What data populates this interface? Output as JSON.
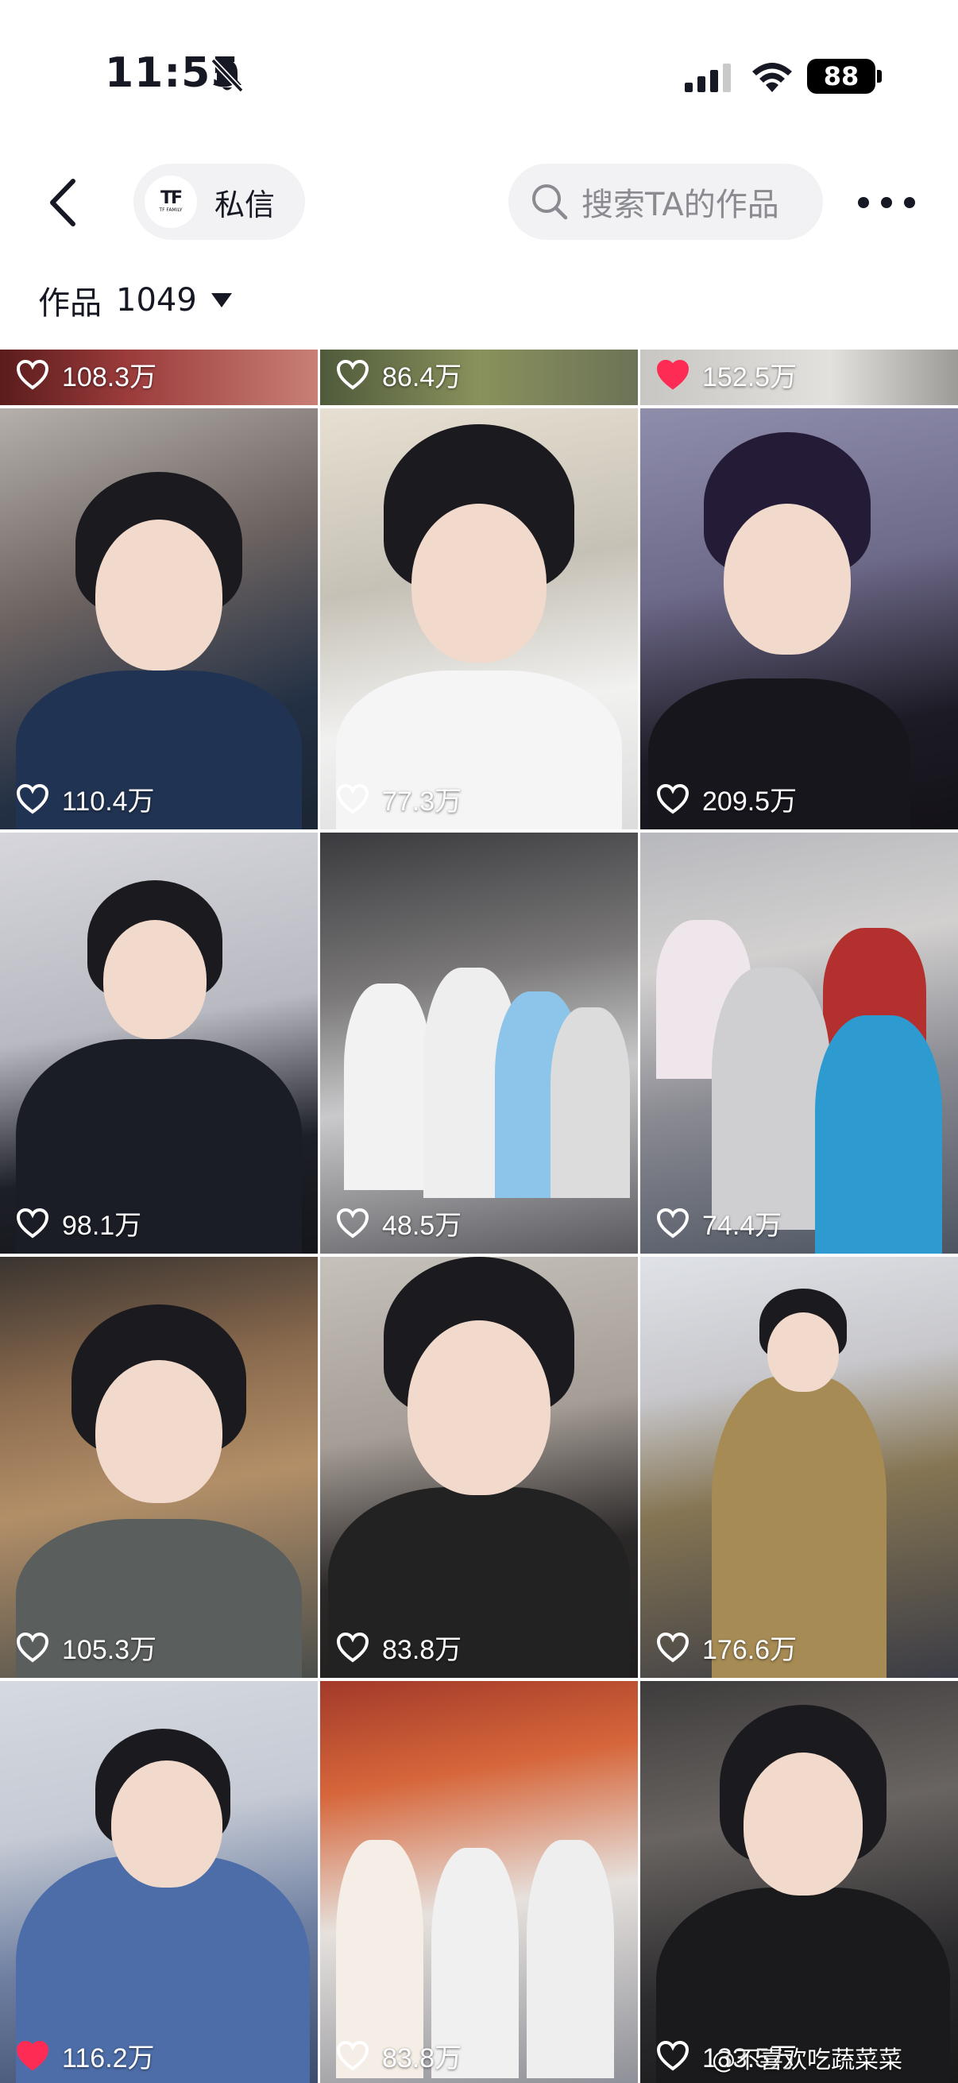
{
  "status_bar": {
    "time": "11:55",
    "battery": "88"
  },
  "header": {
    "profile_chip_label": "私信",
    "logo_mark": "TF",
    "logo_sub": "TF FAMILY",
    "search_placeholder": "搜索TA的作品"
  },
  "works_tab": {
    "label": "作品",
    "count": "1049"
  },
  "videos": [
    {
      "likes": "108.3万",
      "liked": false
    },
    {
      "likes": "86.4万",
      "liked": false
    },
    {
      "likes": "152.5万",
      "liked": true
    },
    {
      "likes": "110.4万",
      "liked": false
    },
    {
      "likes": "77.3万",
      "liked": false
    },
    {
      "likes": "209.5万",
      "liked": false
    },
    {
      "likes": "98.1万",
      "liked": false
    },
    {
      "likes": "48.5万",
      "liked": false
    },
    {
      "likes": "74.4万",
      "liked": false
    },
    {
      "likes": "105.3万",
      "liked": false
    },
    {
      "likes": "83.8万",
      "liked": false
    },
    {
      "likes": "176.6万",
      "liked": false
    },
    {
      "likes": "116.2万",
      "liked": true
    },
    {
      "likes": "83.8万",
      "liked": false
    },
    {
      "likes": "133.5万",
      "liked": false
    }
  ],
  "watermark": "@不喜欢吃蔬菜菜",
  "colors": {
    "heart_liked": "#fe2c55",
    "chip_bg": "#f2f2f4",
    "placeholder": "#8a8b91"
  }
}
